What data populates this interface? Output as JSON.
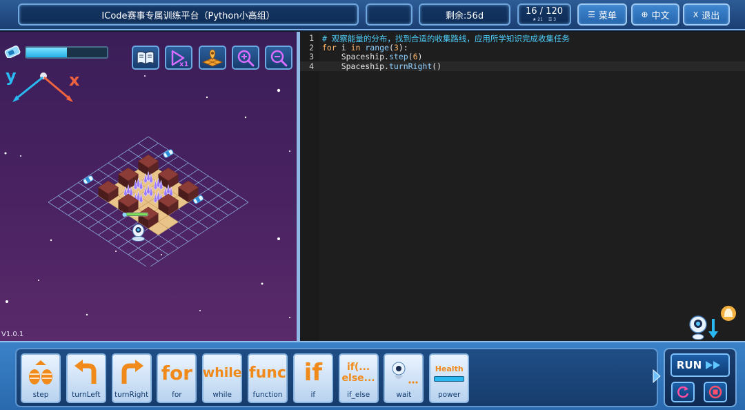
{
  "header": {
    "title": "ICode赛事专属训练平台（Python小高组）",
    "timer": "剩余:56d",
    "progress": "16 / 120",
    "progress_sub_a": "21",
    "progress_sub_b": "3",
    "menu_label": "菜单",
    "lang_label": "中文",
    "exit_label": "退出"
  },
  "game": {
    "energy_fraction": 0.5,
    "axis_y": "y",
    "axis_x": "x",
    "version": "V1.0.1",
    "tools": [
      "book-icon",
      "speed-x1-icon",
      "map-icon",
      "zoom-in-icon",
      "zoom-out-icon"
    ]
  },
  "editor": {
    "lines": [
      {
        "no": "1",
        "parts": [
          {
            "t": "# 观察能量的分布，找到合适的收集路线，应用所学知识完成收集任务",
            "c": "tok-comment"
          }
        ]
      },
      {
        "no": "2",
        "parts": [
          {
            "t": "for",
            "c": "tok-kw"
          },
          {
            "t": " i ",
            "c": ""
          },
          {
            "t": "in",
            "c": "tok-kw"
          },
          {
            "t": " ",
            "c": ""
          },
          {
            "t": "range",
            "c": "tok-fn"
          },
          {
            "t": "(",
            "c": ""
          },
          {
            "t": "3",
            "c": "tok-num"
          },
          {
            "t": "):",
            "c": ""
          }
        ]
      },
      {
        "no": "3",
        "parts": [
          {
            "t": "    Spaceship.",
            "c": ""
          },
          {
            "t": "step",
            "c": "tok-fn"
          },
          {
            "t": "(",
            "c": ""
          },
          {
            "t": "6",
            "c": "tok-num"
          },
          {
            "t": ")",
            "c": ""
          }
        ]
      },
      {
        "no": "4",
        "parts": [
          {
            "t": "    Spaceship.",
            "c": ""
          },
          {
            "t": "turnRight",
            "c": "tok-fn"
          },
          {
            "t": "()",
            "c": ""
          }
        ]
      }
    ]
  },
  "blocks": [
    {
      "id": "step",
      "label": "step",
      "icon_text": ""
    },
    {
      "id": "turnLeft",
      "label": "turnLeft",
      "icon_text": ""
    },
    {
      "id": "turnRight",
      "label": "turnRight",
      "icon_text": ""
    },
    {
      "id": "for",
      "label": "for",
      "icon_text": "for"
    },
    {
      "id": "while",
      "label": "while",
      "icon_text": "while"
    },
    {
      "id": "function",
      "label": "function",
      "icon_text": "func"
    },
    {
      "id": "if",
      "label": "if",
      "icon_text": "if"
    },
    {
      "id": "if_else",
      "label": "if_else",
      "icon_text": "if(...\nelse..."
    },
    {
      "id": "wait",
      "label": "wait",
      "icon_text": ""
    },
    {
      "id": "power",
      "label": "power",
      "icon_text": "Health"
    }
  ],
  "run": {
    "label": "RUN"
  },
  "colors": {
    "accent": "#2666ad",
    "orange": "#f08a1a",
    "cyan": "#4fd0ff"
  }
}
